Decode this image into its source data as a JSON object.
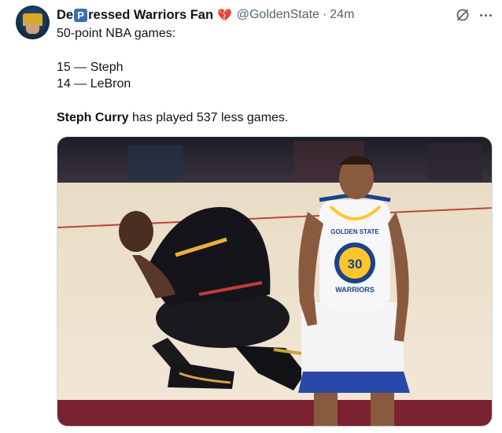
{
  "user": {
    "name_prefix": "De",
    "name_badge": "P",
    "name_suffix": "ressed Warriors Fan",
    "name_emoji": "💔",
    "handle": "@GoldenState",
    "separator": "·",
    "timestamp": "24m",
    "avatar_icon": "avatar-warriors-fan"
  },
  "tweet": {
    "line1": "50-point NBA games:",
    "line2": "15 — Steph",
    "line3": "14 — LeBron",
    "bold_text": "Steph Curry",
    "rest_text": " has played 537 less games."
  },
  "media": {
    "jersey_number": "30",
    "logo_top_text": "GOLDEN STATE",
    "logo_bottom_text": "WARRIORS"
  },
  "icons": {
    "grok": "no-entry-icon",
    "more": "more-icon"
  },
  "colors": {
    "text": "#0f1419",
    "secondary": "#536471",
    "warriors_blue": "#1d428a",
    "warriors_gold": "#ffc72c",
    "cavs_wine": "#6f263d"
  }
}
